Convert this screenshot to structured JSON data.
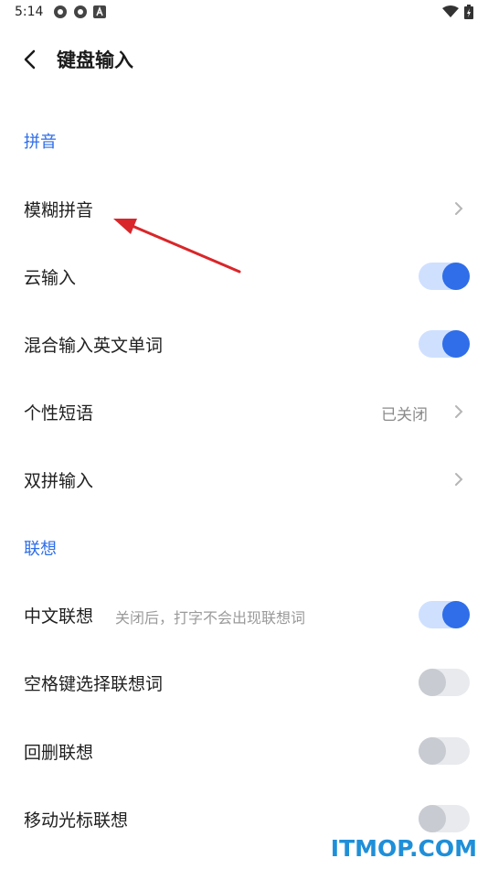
{
  "status_bar": {
    "time": "5:14",
    "left_icons": [
      "settings-gear-icon",
      "settings-gear-icon",
      "a-letter-icon"
    ],
    "right_icons": [
      "wifi-icon",
      "battery-icon"
    ]
  },
  "header": {
    "title": "键盘输入",
    "back_icon": "chevron-left-icon"
  },
  "sections": {
    "pinyin": "拼音",
    "lianxiang": "联想"
  },
  "rows": {
    "fuzzy_pinyin": {
      "label": "模糊拼音"
    },
    "cloud_input": {
      "label": "云输入",
      "toggle": "on"
    },
    "mixed_english": {
      "label": "混合输入英文单词",
      "toggle": "on"
    },
    "personal_phrases": {
      "label": "个性短语",
      "value": "已关闭"
    },
    "shuangpin": {
      "label": "双拼输入"
    },
    "chinese_lianxiang": {
      "label": "中文联想",
      "desc": "关闭后，打字不会出现联想词",
      "toggle": "on"
    },
    "space_select": {
      "label": "空格键选择联想词",
      "toggle": "off"
    },
    "backspace_lianxiang": {
      "label": "回删联想",
      "toggle": "off"
    },
    "move_cursor": {
      "label": "移动光标联想",
      "toggle": "off"
    }
  },
  "watermark": "ITMOP.COM",
  "colors": {
    "accent": "#2f6ee8",
    "annotation_arrow": "#d9262a",
    "watermark": "#1f8fd8"
  }
}
